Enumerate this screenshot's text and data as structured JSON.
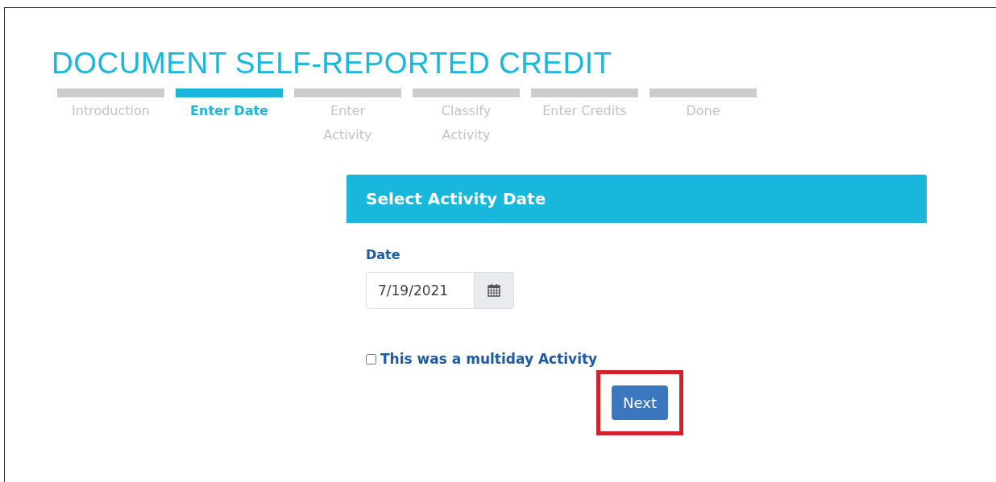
{
  "page": {
    "title": "DOCUMENT SELF-REPORTED CREDIT"
  },
  "steps": [
    {
      "label": "Introduction",
      "selected": false
    },
    {
      "label": "Enter Date",
      "selected": true
    },
    {
      "label": "Enter Activity",
      "selected": false
    },
    {
      "label": "Classify Activity",
      "selected": false
    },
    {
      "label": "Enter Credits",
      "selected": false
    },
    {
      "label": "Done",
      "selected": false
    }
  ],
  "card": {
    "title": "Select Activity Date",
    "date_label": "Date",
    "date_value": "7/19/2021",
    "multiday": {
      "label": "This was a multiday Activity",
      "checked": false
    },
    "next_button": {
      "label": "Next",
      "highlighted": true
    }
  }
}
